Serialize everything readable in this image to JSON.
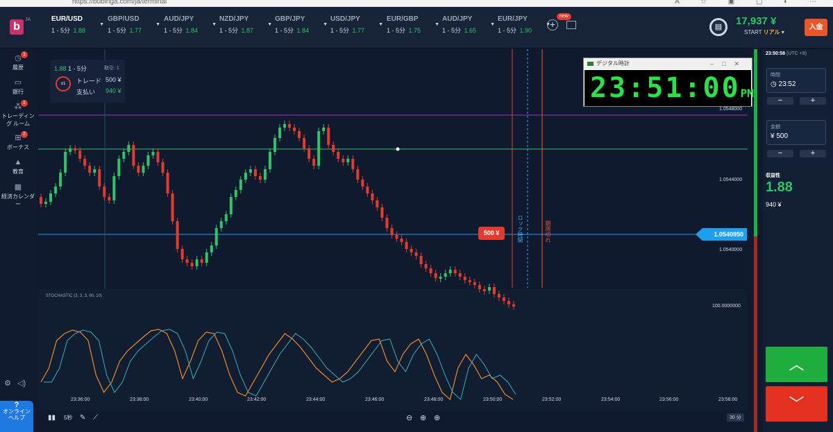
{
  "browser": {
    "url": "https://bubinga.com/ja/terminal"
  },
  "logo": {
    "letter": "b",
    "lang": "JA"
  },
  "assets": [
    {
      "name": "EUR/USD",
      "tf": "1 - 5分",
      "payout": "1.88"
    },
    {
      "name": "GBP/USD",
      "tf": "1 - 5分",
      "payout": "1.77"
    },
    {
      "name": "AUD/JPY",
      "tf": "1 - 5分",
      "payout": "1.84"
    },
    {
      "name": "NZD/JPY",
      "tf": "1 - 5分",
      "payout": "1.87"
    },
    {
      "name": "GBP/JPY",
      "tf": "1 - 5分",
      "payout": "1.84"
    },
    {
      "name": "USD/JPY",
      "tf": "1 - 5分",
      "payout": "1.77"
    },
    {
      "name": "EUR/GBP",
      "tf": "1 - 5分",
      "payout": "1.75"
    },
    {
      "name": "AUD/JPY",
      "tf": "1 - 5分",
      "payout": "1.65"
    },
    {
      "name": "EUR/JPY",
      "tf": "1 - 5分",
      "payout": "1.90"
    }
  ],
  "new_badge": "new",
  "account": {
    "balance": "17,937 ¥",
    "start": "START",
    "mode": "リアル",
    "deposit": "入金"
  },
  "sidebar": [
    {
      "label": "履歴",
      "icon": "history-icon",
      "badge": "1"
    },
    {
      "label": "銀行",
      "icon": "wallet-icon",
      "badge": ""
    },
    {
      "label": "トレーディング ルーム",
      "icon": "trading-room-icon",
      "badge": "1"
    },
    {
      "label": "ボーナス",
      "icon": "gift-icon",
      "badge": "2"
    },
    {
      "label": "教育",
      "icon": "education-icon",
      "badge": ""
    },
    {
      "label": "経済カレンダー",
      "icon": "calendar-icon",
      "badge": ""
    }
  ],
  "help": {
    "q": "?",
    "label": "オンライン ヘルプ"
  },
  "tradebox": {
    "payout": "1.88",
    "tf": "1 - 5分",
    "trades_label": "取引:",
    "trades": "1",
    "clock": "±1",
    "trade_label": "トレード",
    "trade_value": "500 ¥",
    "pay_label": "支払い",
    "pay_value": "940 ¥"
  },
  "clock_window": {
    "title": "デジタル時計",
    "time": "23:51:00",
    "ampm": "PM"
  },
  "price": {
    "current": "1.0540950",
    "trade_amount": "500 ¥",
    "lock": "ロック時間",
    "expiry": "期限切れ"
  },
  "y_axis": [
    "1.0548000",
    "1.0544000",
    "1.0540000"
  ],
  "x_axis": [
    "23:36:00",
    "23:38:00",
    "23:40:00",
    "23:42:00",
    "23:44:00",
    "23:46:00",
    "23:48:00",
    "23:50:00",
    "23:52:00",
    "23:54:00",
    "23:56:00",
    "23:58:00"
  ],
  "stochastic": {
    "label": "STOCHASTIC (3, 3, 3, 90, 10)",
    "top": "100.0000000"
  },
  "toolbar": {
    "interval": "5秒",
    "period": "30 分"
  },
  "right_panel": {
    "server_time": "23:50:58",
    "tz": "(UTC +9)",
    "time_label": "時間",
    "time_value": "23:52",
    "amount_label": "金額",
    "amount_value": "¥ 500",
    "profit_label": "収益性",
    "profit_value": "1.88",
    "profit_amount": "940 ¥"
  },
  "colors": {
    "up": "#1fae3f",
    "down": "#e3301f",
    "accent": "#1ea0f0",
    "bg": "#0f1a2e"
  }
}
